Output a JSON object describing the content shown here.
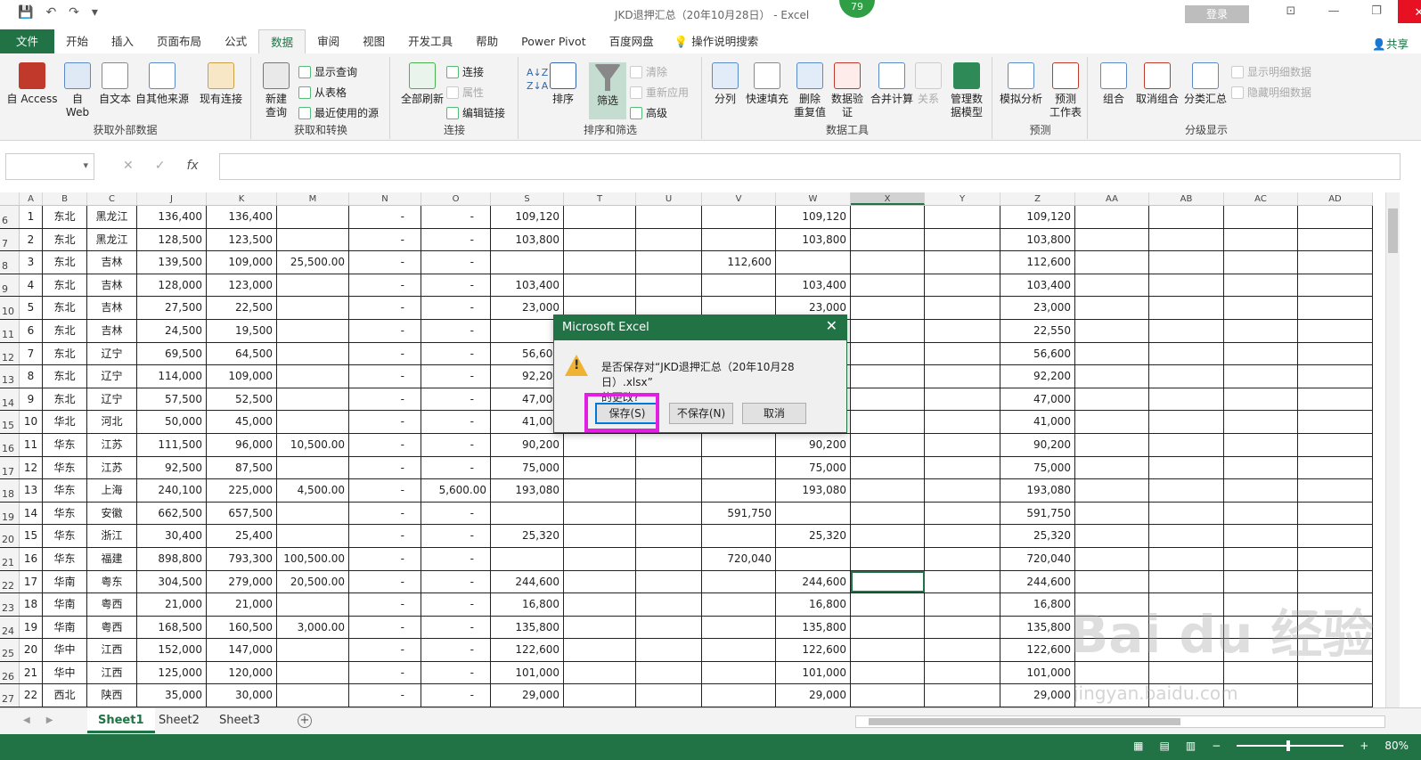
{
  "window": {
    "title": "JKD退押汇总（20年10月28日） - Excel",
    "badge": "79",
    "login_label": "登录",
    "qat": {
      "save_icon": "save-icon",
      "undo_icon": "undo-icon",
      "redo_icon": "redo-icon"
    }
  },
  "tabs": {
    "file": "文件",
    "items": [
      "开始",
      "插入",
      "页面布局",
      "公式",
      "数据",
      "审阅",
      "视图",
      "开发工具",
      "帮助",
      "Power Pivot",
      "百度网盘"
    ],
    "active": "数据",
    "tellme": "操作说明搜索",
    "share": "共享"
  },
  "ribbon": {
    "get_external": {
      "label": "获取外部数据",
      "access": "自 Access",
      "web": "自\nWeb",
      "text": "自文本",
      "other": "自其他来源",
      "existing": "现有连接"
    },
    "get_transform": {
      "label": "获取和转换",
      "new_query": "新建\n查询",
      "show_query": "显示查询",
      "from_table": "从表格",
      "recent": "最近使用的源"
    },
    "connections": {
      "label": "连接",
      "refresh_all": "全部刷新",
      "connections": "连接",
      "properties": "属性",
      "edit_links": "编辑链接"
    },
    "sort_filter": {
      "label": "排序和筛选",
      "sort": "排序",
      "filter": "筛选",
      "clear": "清除",
      "reapply": "重新应用",
      "advanced": "高级"
    },
    "data_tools": {
      "label": "数据工具",
      "split": "分列",
      "flash_fill": "快速填充",
      "remove_dup": "删除\n重复值",
      "validation": "数据验\n证",
      "consolidate": "合并计算",
      "relationships": "关系",
      "data_model": "管理数\n据模型"
    },
    "forecast": {
      "label": "预测",
      "whatif": "模拟分析",
      "sheet": "预测\n工作表"
    },
    "outline": {
      "label": "分级显示",
      "group": "组合",
      "ungroup": "取消组合",
      "subtotal": "分类汇总",
      "show_detail": "显示明细数据",
      "hide_detail": "隐藏明细数据"
    }
  },
  "formula_bar": {
    "fx": "fx",
    "cancel": "✕",
    "enter": "✓"
  },
  "sheet": {
    "columns": [
      "A",
      "B",
      "C",
      "J",
      "K",
      "M",
      "N",
      "O",
      "S",
      "T",
      "U",
      "V",
      "W",
      "X",
      "Y",
      "Z",
      "AA",
      "AB",
      "AC",
      "AD"
    ],
    "rows": [
      {
        "rn": "6",
        "cells": [
          "1",
          "东北",
          "黑龙江",
          "136,400",
          "136,400",
          "",
          "-",
          "-",
          "109,120",
          "",
          "",
          "",
          "109,120",
          "",
          "",
          "109,120",
          "",
          "",
          "",
          ""
        ]
      },
      {
        "rn": "7",
        "cells": [
          "2",
          "东北",
          "黑龙江",
          "128,500",
          "123,500",
          "",
          "-",
          "-",
          "103,800",
          "",
          "",
          "",
          "103,800",
          "",
          "",
          "103,800",
          "",
          "",
          "",
          ""
        ]
      },
      {
        "rn": "8",
        "cells": [
          "3",
          "东北",
          "吉林",
          "139,500",
          "109,000",
          "25,500.00",
          "-",
          "-",
          "",
          "",
          "",
          "112,600",
          "",
          "",
          "",
          "112,600",
          "",
          "",
          "",
          ""
        ]
      },
      {
        "rn": "9",
        "cells": [
          "4",
          "东北",
          "吉林",
          "128,000",
          "123,000",
          "",
          "-",
          "-",
          "103,400",
          "",
          "",
          "",
          "103,400",
          "",
          "",
          "103,400",
          "",
          "",
          "",
          ""
        ]
      },
      {
        "rn": "10",
        "cells": [
          "5",
          "东北",
          "吉林",
          "27,500",
          "22,500",
          "",
          "-",
          "-",
          "23,000",
          "",
          "",
          "",
          "23,000",
          "",
          "",
          "23,000",
          "",
          "",
          "",
          ""
        ]
      },
      {
        "rn": "11",
        "cells": [
          "6",
          "东北",
          "吉林",
          "24,500",
          "19,500",
          "",
          "-",
          "-",
          "",
          "",
          "",
          "",
          "",
          "",
          "",
          "22,550",
          "",
          "",
          "",
          ""
        ]
      },
      {
        "rn": "12",
        "cells": [
          "7",
          "东北",
          "辽宁",
          "69,500",
          "64,500",
          "",
          "-",
          "-",
          "56,600",
          "",
          "",
          "",
          "",
          "",
          "",
          "56,600",
          "",
          "",
          "",
          ""
        ]
      },
      {
        "rn": "13",
        "cells": [
          "8",
          "东北",
          "辽宁",
          "114,000",
          "109,000",
          "",
          "-",
          "-",
          "92,200",
          "",
          "",
          "",
          "",
          "",
          "",
          "92,200",
          "",
          "",
          "",
          ""
        ]
      },
      {
        "rn": "14",
        "cells": [
          "9",
          "东北",
          "辽宁",
          "57,500",
          "52,500",
          "",
          "-",
          "-",
          "47,000",
          "",
          "",
          "",
          "",
          "",
          "",
          "47,000",
          "",
          "",
          "",
          ""
        ]
      },
      {
        "rn": "15",
        "cells": [
          "10",
          "华北",
          "河北",
          "50,000",
          "45,000",
          "",
          "-",
          "-",
          "41,000",
          "",
          "",
          "",
          "",
          "",
          "",
          "41,000",
          "",
          "",
          "",
          ""
        ]
      },
      {
        "rn": "16",
        "cells": [
          "11",
          "华东",
          "江苏",
          "111,500",
          "96,000",
          "10,500.00",
          "-",
          "-",
          "90,200",
          "",
          "",
          "",
          "90,200",
          "",
          "",
          "90,200",
          "",
          "",
          "",
          ""
        ]
      },
      {
        "rn": "17",
        "cells": [
          "12",
          "华东",
          "江苏",
          "92,500",
          "87,500",
          "",
          "-",
          "-",
          "75,000",
          "",
          "",
          "",
          "75,000",
          "",
          "",
          "75,000",
          "",
          "",
          "",
          ""
        ]
      },
      {
        "rn": "18",
        "cells": [
          "13",
          "华东",
          "上海",
          "240,100",
          "225,000",
          "4,500.00",
          "-",
          "5,600.00",
          "193,080",
          "",
          "",
          "",
          "193,080",
          "",
          "",
          "193,080",
          "",
          "",
          "",
          ""
        ]
      },
      {
        "rn": "19",
        "cells": [
          "14",
          "华东",
          "安徽",
          "662,500",
          "657,500",
          "",
          "-",
          "-",
          "",
          "",
          "",
          "591,750",
          "",
          "",
          "",
          "591,750",
          "",
          "",
          "",
          ""
        ]
      },
      {
        "rn": "20",
        "cells": [
          "15",
          "华东",
          "浙江",
          "30,400",
          "25,400",
          "",
          "-",
          "-",
          "25,320",
          "",
          "",
          "",
          "25,320",
          "",
          "",
          "25,320",
          "",
          "",
          "",
          ""
        ]
      },
      {
        "rn": "21",
        "cells": [
          "16",
          "华东",
          "福建",
          "898,800",
          "793,300",
          "100,500.00",
          "-",
          "-",
          "",
          "",
          "",
          "720,040",
          "",
          "",
          "",
          "720,040",
          "",
          "",
          "",
          ""
        ]
      },
      {
        "rn": "22",
        "cells": [
          "17",
          "华南",
          "粤东",
          "304,500",
          "279,000",
          "20,500.00",
          "-",
          "-",
          "244,600",
          "",
          "",
          "",
          "244,600",
          "",
          "",
          "244,600",
          "",
          "",
          "",
          ""
        ]
      },
      {
        "rn": "23",
        "cells": [
          "18",
          "华南",
          "粤西",
          "21,000",
          "21,000",
          "",
          "-",
          "-",
          "16,800",
          "",
          "",
          "",
          "16,800",
          "",
          "",
          "16,800",
          "",
          "",
          "",
          ""
        ]
      },
      {
        "rn": "24",
        "cells": [
          "19",
          "华南",
          "粤西",
          "168,500",
          "160,500",
          "3,000.00",
          "-",
          "-",
          "135,800",
          "",
          "",
          "",
          "135,800",
          "",
          "",
          "135,800",
          "",
          "",
          "",
          ""
        ]
      },
      {
        "rn": "25",
        "cells": [
          "20",
          "华中",
          "江西",
          "152,000",
          "147,000",
          "",
          "-",
          "-",
          "122,600",
          "",
          "",
          "",
          "122,600",
          "",
          "",
          "122,600",
          "",
          "",
          "",
          ""
        ]
      },
      {
        "rn": "26",
        "cells": [
          "21",
          "华中",
          "江西",
          "125,000",
          "120,000",
          "",
          "-",
          "-",
          "101,000",
          "",
          "",
          "",
          "101,000",
          "",
          "",
          "101,000",
          "",
          "",
          "",
          ""
        ]
      },
      {
        "rn": "27",
        "cells": [
          "22",
          "西北",
          "陕西",
          "35,000",
          "30,000",
          "",
          "-",
          "-",
          "29,000",
          "",
          "",
          "",
          "29,000",
          "",
          "",
          "29,000",
          "",
          "",
          "",
          ""
        ]
      }
    ],
    "tabs": [
      "Sheet1",
      "Sheet2",
      "Sheet3"
    ],
    "active_tab": "Sheet1"
  },
  "status": {
    "zoom": "80%"
  },
  "dialog": {
    "title": "Microsoft Excel",
    "message_line1": "是否保存对“JKD退押汇总（20年10月28日）.xlsx”",
    "message_line2": "的更改?",
    "save": "保存(S)",
    "dont_save": "不保存(N)",
    "cancel": "取消",
    "close": "✕"
  },
  "watermark": {
    "main": "Bai du 经验",
    "sub": "jingyan.baidu.com"
  }
}
